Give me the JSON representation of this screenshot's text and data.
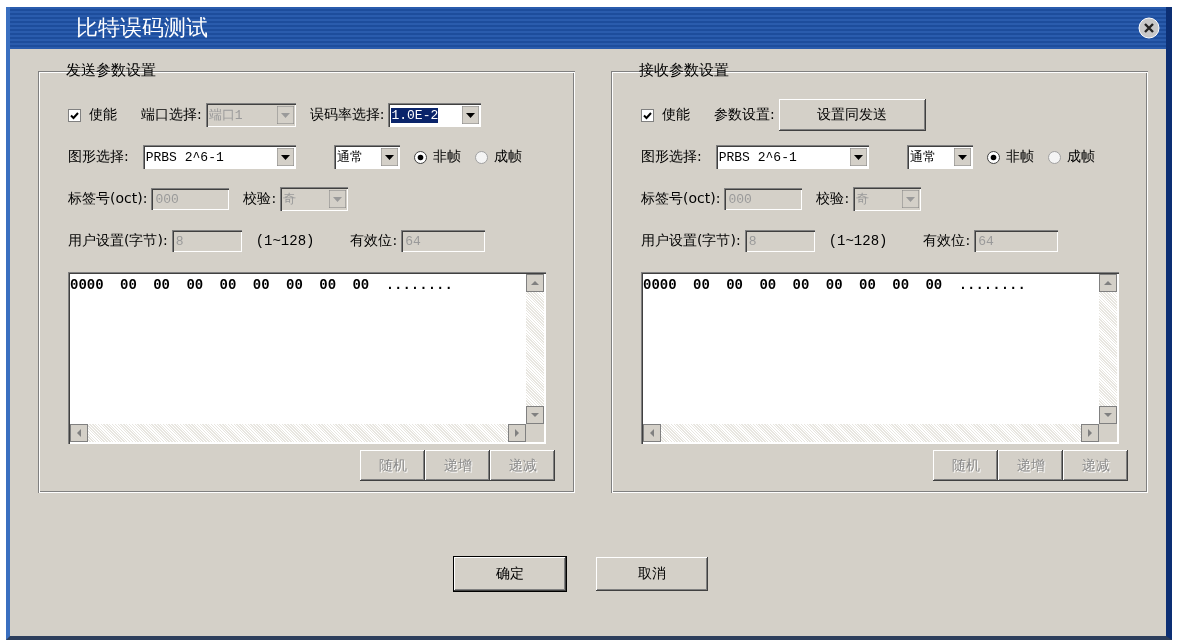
{
  "window": {
    "title": "比特误码测试"
  },
  "panels": [
    {
      "title": "发送参数设置",
      "enable": {
        "label": "使能",
        "checked": true
      },
      "top_controls": [
        {
          "kind": "select",
          "label": "端口选择:",
          "value": "端口1",
          "disabled": true,
          "focused": false
        },
        {
          "kind": "select",
          "label": "误码率选择:",
          "value": "1.0E-2",
          "disabled": false,
          "focused": true
        }
      ],
      "pattern": {
        "label": "图形选择:",
        "value": "PRBS 2^6-1"
      },
      "mode": {
        "value": "通常"
      },
      "framing": [
        {
          "label": "非帧",
          "selected": true
        },
        {
          "label": "成帧",
          "selected": false
        }
      ],
      "tag": {
        "label": "标签号(oct):",
        "value": "000",
        "disabled": true
      },
      "parity": {
        "label": "校验:",
        "value": "奇",
        "disabled": true
      },
      "user_bytes": {
        "label": "用户设置(字节):",
        "value": "8",
        "disabled": true
      },
      "range": "(1~128)",
      "valid_bits": {
        "label": "有效位:",
        "value": "64",
        "disabled": true
      },
      "data": "0000 00 00 00 00 00 00 00 00 ........",
      "buttons": [
        {
          "label": "随机",
          "disabled": true
        },
        {
          "label": "递增",
          "disabled": true
        },
        {
          "label": "递减",
          "disabled": true
        }
      ]
    },
    {
      "title": "接收参数设置",
      "enable": {
        "label": "使能",
        "checked": true
      },
      "top_controls": [
        {
          "kind": "button",
          "label": "参数设置:",
          "value": "设置同发送"
        }
      ],
      "pattern": {
        "label": "图形选择:",
        "value": "PRBS 2^6-1"
      },
      "mode": {
        "value": "通常"
      },
      "framing": [
        {
          "label": "非帧",
          "selected": true
        },
        {
          "label": "成帧",
          "selected": false
        }
      ],
      "tag": {
        "label": "标签号(oct):",
        "value": "000",
        "disabled": true
      },
      "parity": {
        "label": "校验:",
        "value": "奇",
        "disabled": true
      },
      "user_bytes": {
        "label": "用户设置(字节):",
        "value": "8",
        "disabled": true
      },
      "range": "(1~128)",
      "valid_bits": {
        "label": "有效位:",
        "value": "64",
        "disabled": true
      },
      "data": "0000 00 00 00 00 00 00 00 00 ........",
      "buttons": [
        {
          "label": "随机",
          "disabled": true
        },
        {
          "label": "递增",
          "disabled": true
        },
        {
          "label": "递减",
          "disabled": true
        }
      ]
    }
  ],
  "footer_buttons": [
    {
      "label": "确定",
      "default": true
    },
    {
      "label": "取消",
      "default": false
    }
  ]
}
